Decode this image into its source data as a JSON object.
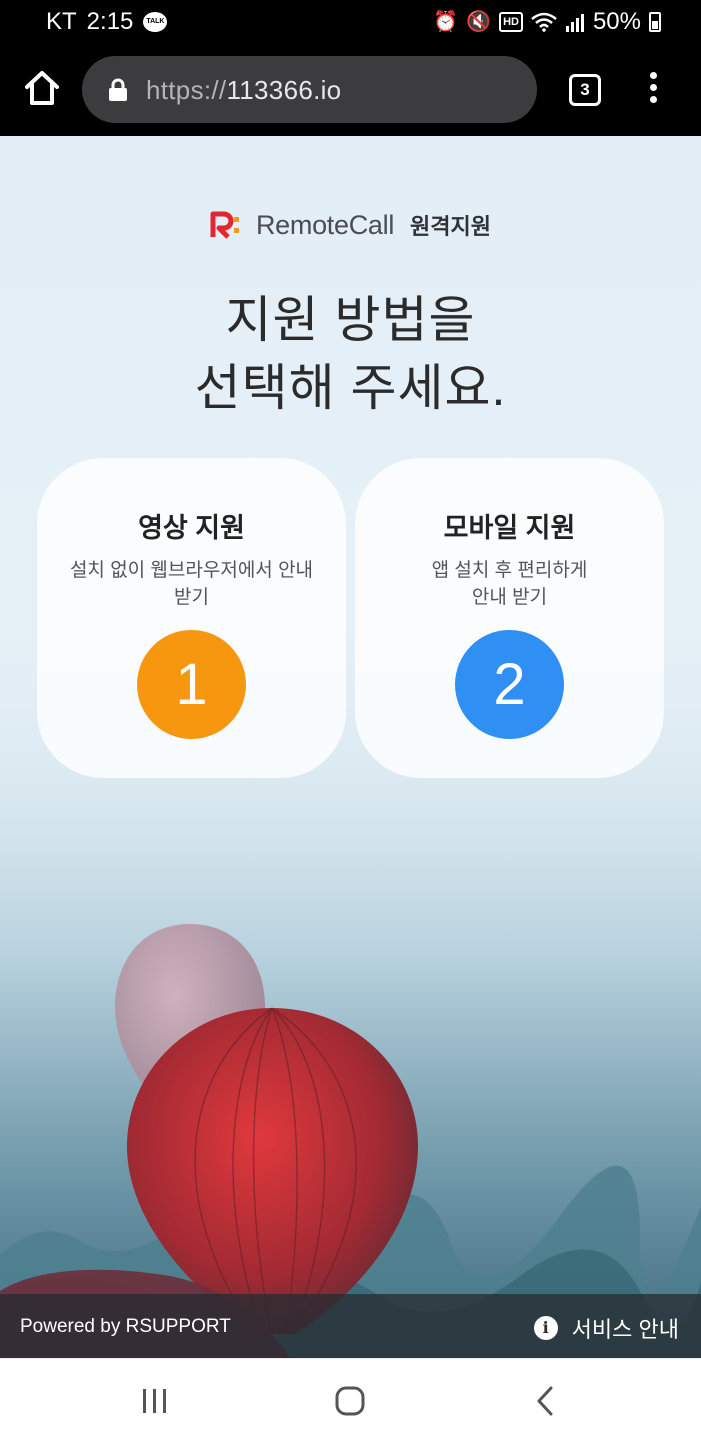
{
  "status_bar": {
    "carrier": "KT",
    "time": "2:15",
    "talk_badge": "TALK",
    "hd_label": "HD",
    "battery": "50%"
  },
  "browser": {
    "url_prefix": "https://",
    "url_host": "113366.io",
    "tab_count": "3"
  },
  "page": {
    "logo_name": "RemoteCall",
    "logo_sub": "원격지원",
    "heading_line1": "지원 방법을",
    "heading_line2": "선택해 주세요.",
    "options": [
      {
        "title": "영상 지원",
        "desc_line1": "설치 없이 웹브라우저에서 안내",
        "desc_line2": "받기",
        "number": "1",
        "color": "#f7960f"
      },
      {
        "title": "모바일 지원",
        "desc_line1": "앱 설치 후 편리하게",
        "desc_line2": "안내 받기",
        "number": "2",
        "color": "#2f8ff2"
      }
    ]
  },
  "footer": {
    "powered_by": "Powered by RSUPPORT",
    "info_glyph": "i",
    "service_label": "서비스 안내"
  },
  "icons": {
    "home": "home-icon",
    "lock": "lock-icon",
    "tabs": "tabs-icon",
    "menu": "more-vert-icon",
    "recents": "recents-icon",
    "nav_home": "nav-home-icon",
    "back": "back-icon",
    "info": "info-icon"
  }
}
